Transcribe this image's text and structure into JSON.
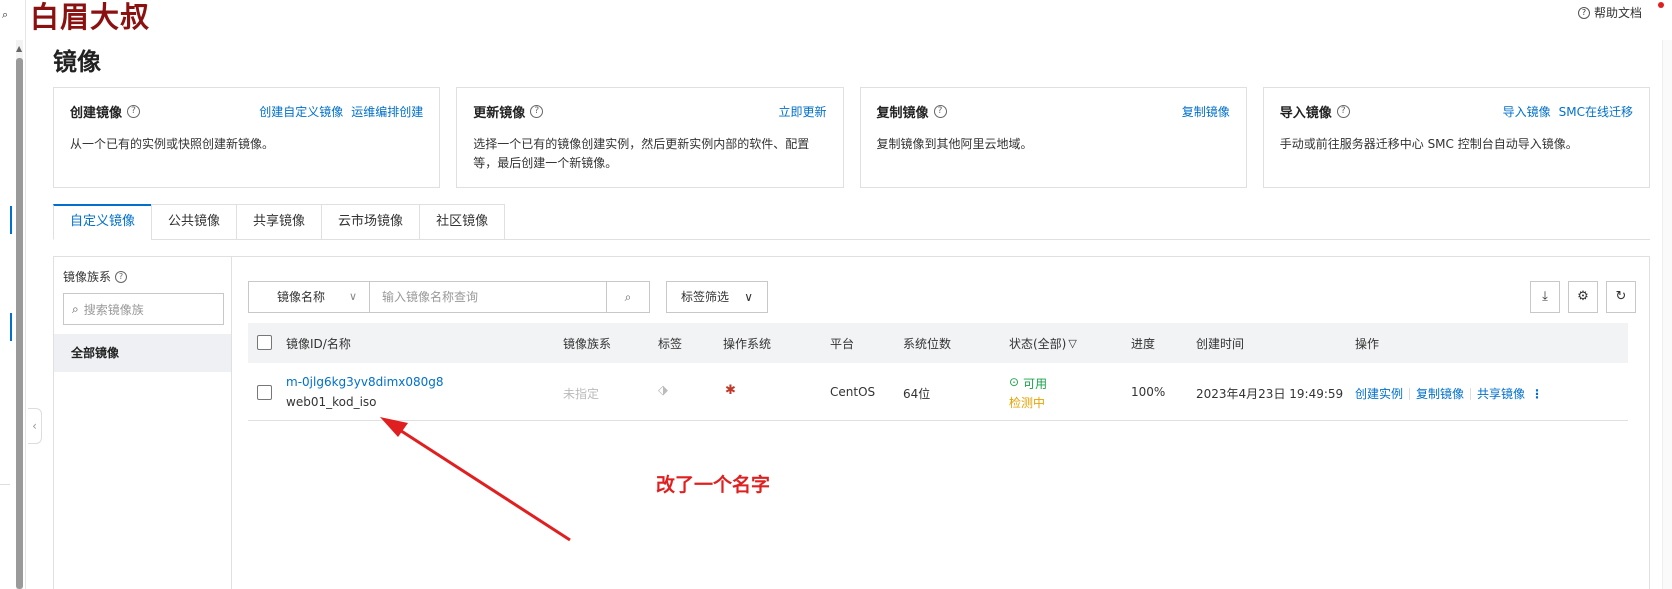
{
  "watermark": "白眉大叔",
  "help": {
    "label": "帮助文档"
  },
  "page_title": "镜像",
  "cards": [
    {
      "title": "创建镜像",
      "links": [
        "创建自定义镜像",
        "运维编排创建"
      ],
      "desc": "从一个已有的实例或快照创建新镜像。"
    },
    {
      "title": "更新镜像",
      "links": [
        "立即更新"
      ],
      "desc": "选择一个已有的镜像创建实例，然后更新实例内部的软件、配置等，最后创建一个新镜像。"
    },
    {
      "title": "复制镜像",
      "links": [
        "复制镜像"
      ],
      "desc": "复制镜像到其他阿里云地域。"
    },
    {
      "title": "导入镜像",
      "links": [
        "导入镜像",
        "SMC在线迁移"
      ],
      "desc": "手动或前往服务器迁移中心 SMC 控制台自动导入镜像。"
    }
  ],
  "tabs": [
    "自定义镜像",
    "公共镜像",
    "共享镜像",
    "云市场镜像",
    "社区镜像"
  ],
  "family": {
    "title": "镜像族系",
    "search_placeholder": "搜索镜像族",
    "all_label": "全部镜像"
  },
  "toolbar": {
    "search_field": "镜像名称",
    "search_placeholder": "输入镜像名称查询",
    "tag_filter": "标签筛选"
  },
  "table": {
    "headers": {
      "id_name": "镜像ID/名称",
      "family": "镜像族系",
      "tag": "标签",
      "os": "操作系统",
      "platform": "平台",
      "bits": "系统位数",
      "status": "状态(全部)",
      "progress": "进度",
      "created": "创建时间",
      "actions": "操作"
    },
    "rows": [
      {
        "id": "m-0jlg6kg3yv8dimx080g8",
        "name": "web01_kod_iso",
        "family": "未指定",
        "platform": "CentOS",
        "bits": "64位",
        "status": "可用",
        "check": "检测中",
        "progress": "100%",
        "created": "2023年4月23日 19:49:59",
        "actions": [
          "创建实例",
          "复制镜像",
          "共享镜像"
        ]
      }
    ]
  },
  "annotation": "改了一个名字",
  "colors": {
    "accent": "#0070cc",
    "annotation": "#e02020",
    "watermark": "#8b1111",
    "success": "#1aa34a",
    "warning": "#e6a200"
  }
}
